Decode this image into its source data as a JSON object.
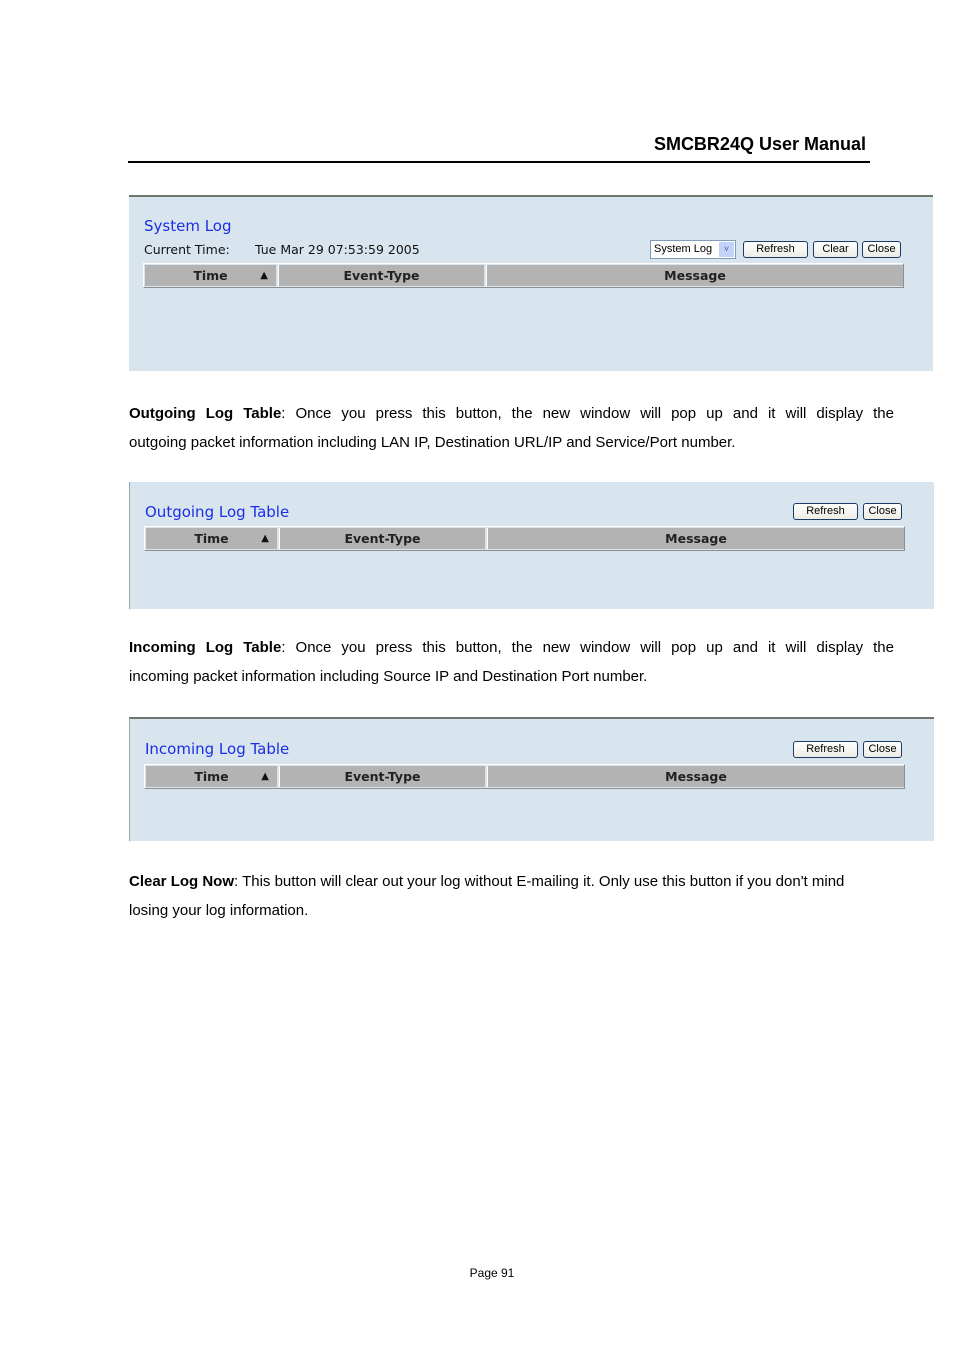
{
  "document": {
    "header_title": "SMCBR24Q User Manual",
    "page_number": "Page 91"
  },
  "system_log_panel": {
    "title": "System Log",
    "current_time_label": "Current Time:",
    "current_time_value": "Tue Mar 29 07:53:59 2005",
    "log_type_select": {
      "selected": "System Log"
    },
    "buttons": {
      "refresh": "Refresh",
      "clear": "Clear",
      "close": "Close"
    },
    "columns": [
      "Time",
      "Event-Type",
      "Message"
    ],
    "sort_indicator": "▲",
    "rows": []
  },
  "outgoing_paragraph": {
    "term": "Outgoing Log Table",
    "line1": ": Once you press this button, the new window will pop up and it will display the",
    "line2": "outgoing packet information including LAN IP, Destination URL/IP and Service/Port number."
  },
  "outgoing_log_panel": {
    "title": "Outgoing Log Table",
    "buttons": {
      "refresh": "Refresh",
      "close": "Close"
    },
    "columns": [
      "Time",
      "Event-Type",
      "Message"
    ],
    "sort_indicator": "▲",
    "rows": []
  },
  "incoming_paragraph": {
    "term": "Incoming Log Table",
    "line1": ": Once you press this button, the new window will pop up and it will display the",
    "line2": "incoming packet information including Source IP and Destination Port number."
  },
  "incoming_log_panel": {
    "title": "Incoming Log Table",
    "buttons": {
      "refresh": "Refresh",
      "close": "Close"
    },
    "columns": [
      "Time",
      "Event-Type",
      "Message"
    ],
    "sort_indicator": "▲",
    "rows": []
  },
  "clear_paragraph": {
    "term": "Clear Log Now",
    "line1": ": This button will clear out your log without E-mailing it. Only use this button if you don't mind",
    "line2": "losing your log information."
  }
}
